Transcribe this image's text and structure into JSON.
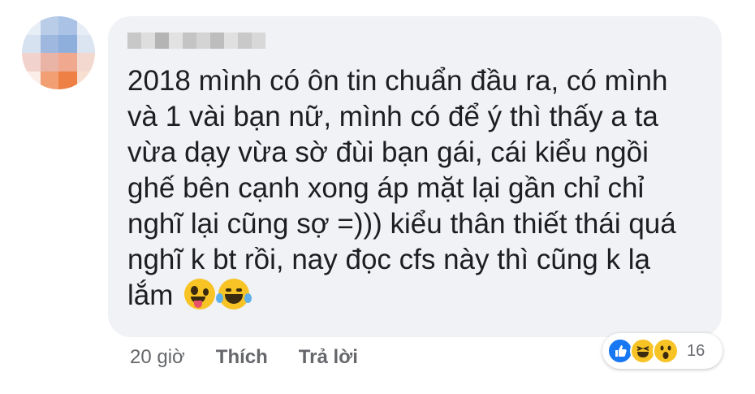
{
  "comment": {
    "lines": [
      "2018 mình có ôn tin chuẩn đầu ra, có mình",
      "và 1 vài bạn nữ, mình có để ý thì thấy a ta",
      "vừa dạy vừa sờ đùi bạn gái, cái kiểu ngồi",
      "ghế bên cạnh xong áp mặt lại gần chỉ chỉ",
      "nghĩ lại cũng sợ =))) kiểu thân thiết thái quá",
      "nghĩ k bt rồi, nay đọc cfs này thì cũng k lạ",
      "lắm"
    ],
    "inline_emojis": [
      "zany-face-emoji",
      "laughing-tears-emoji"
    ]
  },
  "meta": {
    "time": "20 giờ",
    "like_label": "Thích",
    "reply_label": "Trả lời"
  },
  "reactions": {
    "icons": [
      "like-reaction-icon",
      "haha-reaction-icon",
      "wow-reaction-icon"
    ],
    "count": "16"
  },
  "colors": {
    "bubble": "#f0f2f5",
    "text": "#1c1e21",
    "meta": "#65676b",
    "like_blue": "#1877f2",
    "emoji_yellow": "#f7c325"
  }
}
